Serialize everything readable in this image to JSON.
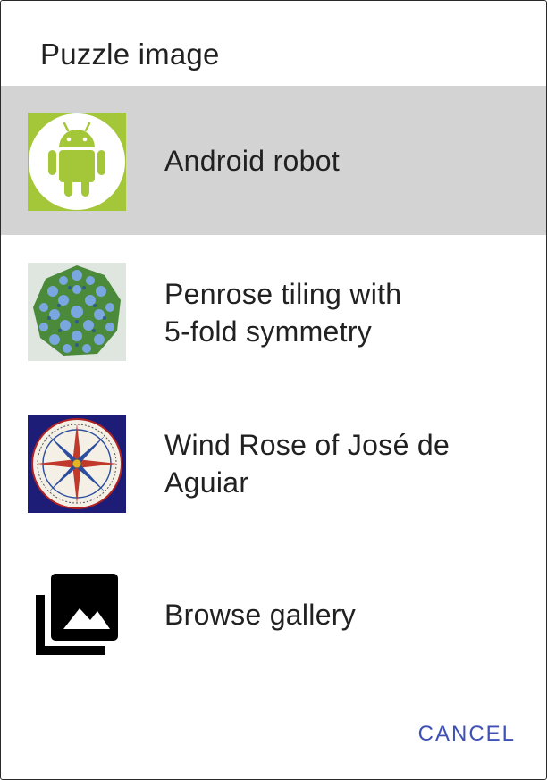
{
  "dialog": {
    "title": "Puzzle image",
    "items": [
      {
        "label": "Android robot",
        "icon": "android-robot-icon",
        "selected": true
      },
      {
        "label_line1": "Penrose tiling with",
        "label_line2": "5-fold symmetry",
        "icon": "penrose-tiling-icon"
      },
      {
        "label_line1": "Wind Rose of José de",
        "label_line2": "Aguiar",
        "icon": "wind-rose-icon"
      },
      {
        "label": "Browse gallery",
        "icon": "gallery-icon"
      }
    ],
    "cancel_label": "CANCEL"
  },
  "colors": {
    "selected_bg": "#d3d3d3",
    "accent": "#3f51b5",
    "android_green": "#a4c639",
    "text": "#212121"
  }
}
